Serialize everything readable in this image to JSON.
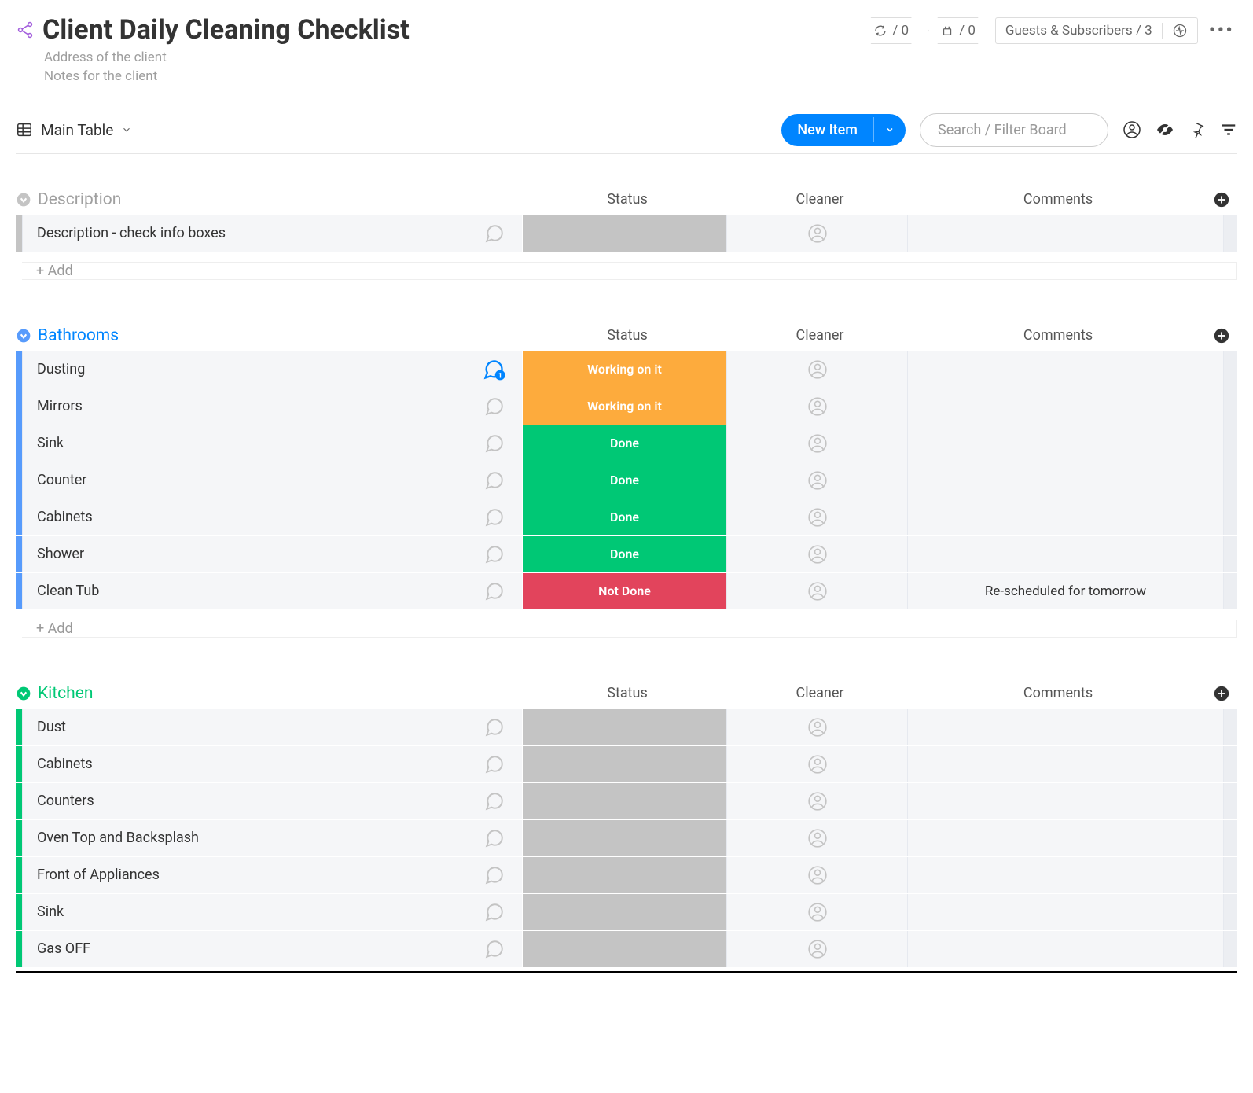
{
  "header": {
    "title": "Client Daily Cleaning Checklist",
    "subtitle1": "Address of the client",
    "subtitle2": "Notes for the client",
    "badge1_count": "0",
    "badge2_count": "0",
    "guests_label": "Guests & Subscribers",
    "guests_count": "3"
  },
  "toolbar": {
    "view_label": "Main Table",
    "new_item_label": "New Item",
    "search_placeholder": "Search / Filter Board"
  },
  "columns": {
    "status": "Status",
    "cleaner": "Cleaner",
    "comments": "Comments"
  },
  "add_row_label": "+ Add",
  "status_colors": {
    "Working on it": "#fdab3d",
    "Done": "#00c875",
    "Not Done": "#e2445c",
    "": "#c4c4c4"
  },
  "groups": [
    {
      "name": "Description",
      "color": "#c4c4c4",
      "title_color": "#a0a0a0",
      "items": [
        {
          "name": "Description - check info boxes",
          "status": "",
          "comments": "",
          "chat_active": false
        }
      ]
    },
    {
      "name": "Bathrooms",
      "color": "#579bfc",
      "title_color": "#0085ff",
      "items": [
        {
          "name": "Dusting",
          "status": "Working on it",
          "comments": "",
          "chat_active": true
        },
        {
          "name": "Mirrors",
          "status": "Working on it",
          "comments": "",
          "chat_active": false
        },
        {
          "name": "Sink",
          "status": "Done",
          "comments": "",
          "chat_active": false
        },
        {
          "name": "Counter",
          "status": "Done",
          "comments": "",
          "chat_active": false
        },
        {
          "name": "Cabinets",
          "status": "Done",
          "comments": "",
          "chat_active": false
        },
        {
          "name": "Shower",
          "status": "Done",
          "comments": "",
          "chat_active": false
        },
        {
          "name": "Clean Tub",
          "status": "Not Done",
          "comments": "Re-scheduled for tomorrow",
          "chat_active": false
        }
      ]
    },
    {
      "name": "Kitchen",
      "color": "#00c875",
      "title_color": "#00c875",
      "items": [
        {
          "name": "Dust",
          "status": "",
          "comments": "",
          "chat_active": false
        },
        {
          "name": "Cabinets",
          "status": "",
          "comments": "",
          "chat_active": false
        },
        {
          "name": "Counters",
          "status": "",
          "comments": "",
          "chat_active": false
        },
        {
          "name": "Oven Top and Backsplash",
          "status": "",
          "comments": "",
          "chat_active": false
        },
        {
          "name": "Front of Appliances",
          "status": "",
          "comments": "",
          "chat_active": false
        },
        {
          "name": "Sink",
          "status": "",
          "comments": "",
          "chat_active": false
        },
        {
          "name": "Gas OFF",
          "status": "",
          "comments": "",
          "chat_active": false
        }
      ]
    }
  ]
}
